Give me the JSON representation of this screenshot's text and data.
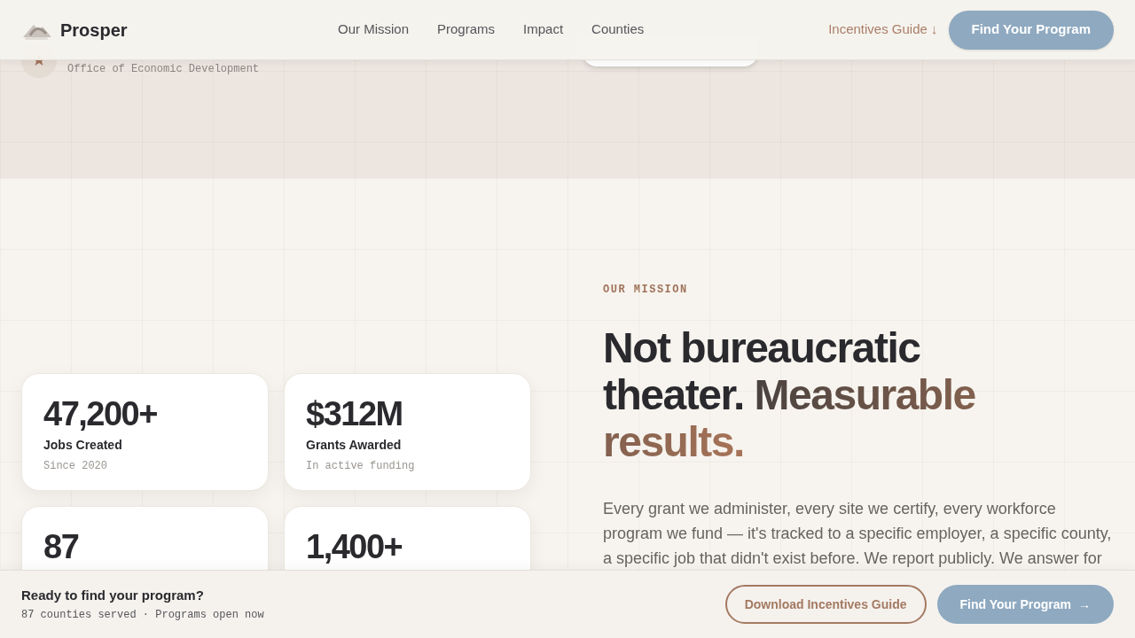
{
  "header": {
    "brand": "Prosper",
    "nav": [
      {
        "label": "Our Mission"
      },
      {
        "label": "Programs"
      },
      {
        "label": "Impact"
      },
      {
        "label": "Counties"
      }
    ],
    "guide_link": "Incentives Guide ↓",
    "cta": "Find Your Program"
  },
  "agency": "Office of Economic Development",
  "stats": [
    {
      "value": "47,200+",
      "label": "Jobs Created",
      "note": "Since 2020"
    },
    {
      "value": "$312M",
      "label": "Grants Awarded",
      "note": "In active funding"
    },
    {
      "value": "87"
    },
    {
      "value": "1,400+"
    }
  ],
  "mission": {
    "eyebrow": "OUR MISSION",
    "headline": "Not bureaucratic theater.",
    "accent": "Measurable results.",
    "body": "Every grant we administer, every site we certify, every workforce program we fund — it's tracked to a specific employer, a specific county, a specific job that didn't exist before. We report publicly. We answer for"
  },
  "footer_bar": {
    "title": "Ready to find your program?",
    "subtitle": "87 counties served · Programs open now",
    "secondary": "Download Incentives Guide",
    "primary": "Find Your Program",
    "primary_arrow": "→"
  }
}
